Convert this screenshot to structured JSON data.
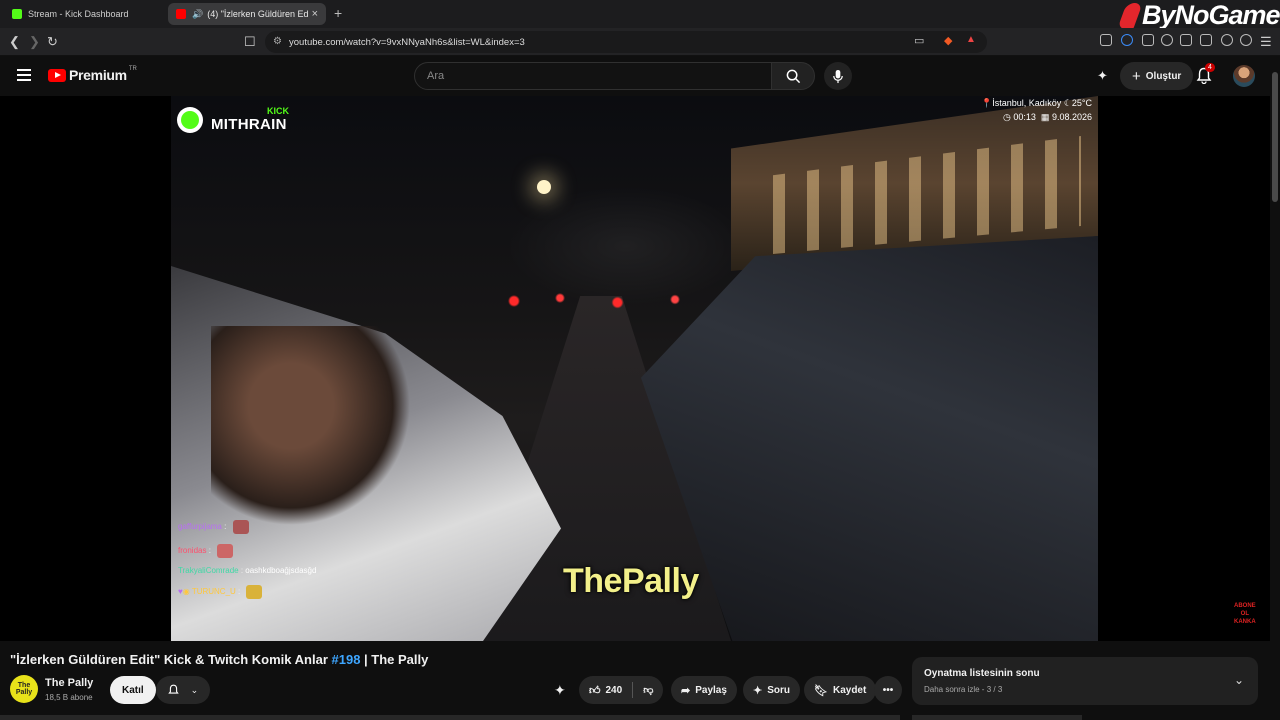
{
  "browser": {
    "tabs": [
      {
        "label": "Stream - Kick Dashboard",
        "favicon": "kick-icon",
        "color": "#53fc18"
      },
      {
        "label": "(4) \"İzlerken Güldüren Edit\" Ki",
        "favicon": "youtube-icon",
        "color": "#ff0000"
      }
    ],
    "url": "youtube.com/watch?v=9vxNNyaNh6s&list=WL&index=3",
    "brand_overlay": "ByNoGame"
  },
  "youtube": {
    "logo_text": "Premium",
    "logo_region": "TR",
    "search_placeholder": "Ara",
    "create_label": "Oluştur",
    "notifications_count": "4"
  },
  "video": {
    "watermark_platform": "KICK",
    "watermark_name": "MITHRAIN",
    "location": "İstanbul, Kadıköy",
    "temperature": "25°C",
    "time": "00:13",
    "date": "9.08.2026",
    "chat": [
      {
        "user": "gaffurpijama",
        "message": "",
        "color": "#b86ef2"
      },
      {
        "user": "fronidas",
        "message": "",
        "color": "#ff4f6d"
      },
      {
        "user": "TrakyaliComrade",
        "message": "oashkdboağjsdasğd",
        "color": "#3fd9a6"
      },
      {
        "user": "TURUNC_U",
        "message": "",
        "color": "#ffc83d"
      }
    ],
    "overlay_name": "ThePally",
    "abone_text": [
      "ABONE",
      "OL",
      "KANKA"
    ]
  },
  "meta": {
    "title_prefix": "\"İzlerken Güldüren Edit\" Kick & Twitch Komik Anlar ",
    "title_tag": "#198",
    "title_suffix": " | The Pally",
    "channel_name": "The Pally",
    "channel_avatar_text": "The Pally",
    "subscribers": "18,5 B abone",
    "join_label": "Katıl",
    "likes": "240",
    "share_label": "Paylaş",
    "ask_label": "Soru",
    "save_label": "Kaydet"
  },
  "playlist": {
    "heading": "Oynatma listesinin sonu",
    "subtitle": "Daha sonra izle - 3 / 3"
  },
  "colors": {
    "accent": "#ff0000",
    "link": "#3ea6ff",
    "kick": "#53fc18"
  }
}
